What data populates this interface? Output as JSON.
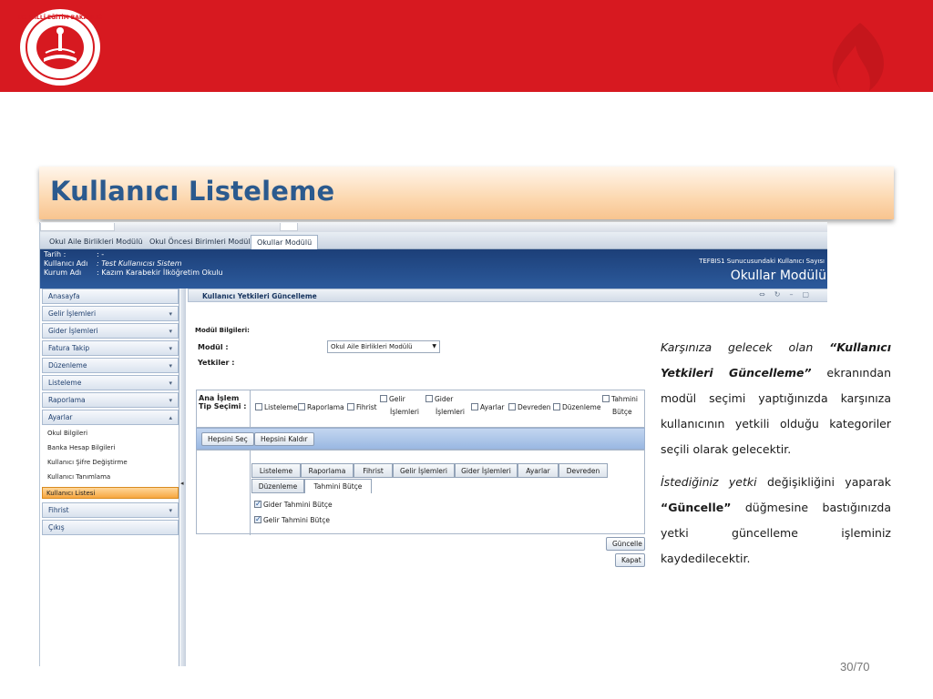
{
  "logo": {
    "text": "T.C. MİLLÎ EĞİTİM BAKANLIĞI"
  },
  "slide_title": "Kullanıcı Listeleme",
  "app": {
    "module_tabs": [
      "Okul Aile Birlikleri Modülü",
      "Okul Öncesi Birimleri Modülü",
      "Okullar Modülü"
    ],
    "active_module_tab": 2,
    "info": {
      "tarih_label": "Tarih :",
      "tarih_value": ": -",
      "kullanici_label": "Kullanıcı Adı",
      "kullanici_value": ": Test Kullanıcısı Sistem",
      "kurum_label": "Kurum Adı",
      "kurum_value": ": Kazım Karabekir İlköğretim Okulu",
      "server_text": "TEFBIS1 Sunucusundaki Kullanıcı Sayısı",
      "module_title": "Okullar Modülü"
    },
    "sidebar": {
      "items": [
        {
          "label": "Anasayfa",
          "arrow": ""
        },
        {
          "label": "Gelir İşlemleri",
          "arrow": "▾"
        },
        {
          "label": "Gider İşlemleri",
          "arrow": "▾"
        },
        {
          "label": "Fatura Takip",
          "arrow": "▾"
        },
        {
          "label": "Düzenleme",
          "arrow": "▾"
        },
        {
          "label": "Listeleme",
          "arrow": "▾"
        },
        {
          "label": "Raporlama",
          "arrow": "▾"
        },
        {
          "label": "Ayarlar",
          "arrow": "▴"
        }
      ],
      "sub_items": [
        "Okul Bilgileri",
        "Banka Hesap Bilgileri",
        "Kullanıcı Şifre Değiştirme",
        "Kullanıcı Tanımlama"
      ],
      "active_sub": "Kullanıcı Listesi",
      "bottom_items": [
        {
          "label": "Fihrist",
          "arrow": "▾"
        },
        {
          "label": "Çıkış",
          "arrow": ""
        }
      ]
    },
    "panel": {
      "title": "Kullanıcı Yetkileri Güncelleme",
      "section_label": "Modül Bilgileri:",
      "modul_label": "Modül :",
      "modul_value": "Okul Aile Birlikleri Modülü",
      "yetkiler_label": "Yetkiler :",
      "ana_islem_line1": "Ana İşlem",
      "ana_islem_line2": "Tip Seçimi :",
      "checkboxes": [
        {
          "l1": "Listeleme",
          "l2": ""
        },
        {
          "l1": "Raporlama",
          "l2": ""
        },
        {
          "l1": "Fihrist",
          "l2": ""
        },
        {
          "l1": "Gelir",
          "l2": "İşlemleri"
        },
        {
          "l1": "Gider",
          "l2": "İşlemleri"
        },
        {
          "l1": "Ayarlar",
          "l2": ""
        },
        {
          "l1": "Devreden",
          "l2": ""
        },
        {
          "l1": "Düzenleme",
          "l2": ""
        },
        {
          "l1": "Tahmini",
          "l2": "Bütçe"
        }
      ],
      "hepsini_sec": "Hepsini Seç",
      "hepsini_kaldir": "Hepsini Kaldır",
      "inner_tabs_row1": [
        "Listeleme",
        "Raporlama",
        "Fihrist",
        "Gelir İşlemleri",
        "Gider İşlemleri",
        "Ayarlar",
        "Devreden"
      ],
      "inner_tabs_row2": [
        "Düzenleme",
        "Tahmini Bütçe"
      ],
      "active_inner_tab": "Tahmini Bütçe",
      "sub_checks": [
        {
          "label": "Gider Tahmini Bütçe",
          "checked": true
        },
        {
          "label": "Gelir Tahmini Bütçe",
          "checked": true
        }
      ],
      "guncelle": "Güncelle",
      "kapat": "Kapat"
    }
  },
  "description": {
    "p1_a": "Karşınıza gelecek olan ",
    "p1_b": "“Kullanıcı Yetkileri Güncelleme”",
    "p1_c": " ekranından modül seçimi yaptığınızda karşınıza kullanıcının yetkili olduğu kategoriler seçili olarak gelecektir.",
    "p2_a": "İstediğiniz yetki",
    "p2_b": " değişikliğini yaparak ",
    "p2_c": "“Güncelle”",
    "p2_d": " düğmesine bastığınızda yetki güncelleme işleminiz kaydedilecektir."
  },
  "page_number": "30/70",
  "colors": {
    "brand_red": "#d71920",
    "title_blue": "#2b5a8e",
    "header_navy": "#1c3f78",
    "active_orange": "#f7a740"
  }
}
